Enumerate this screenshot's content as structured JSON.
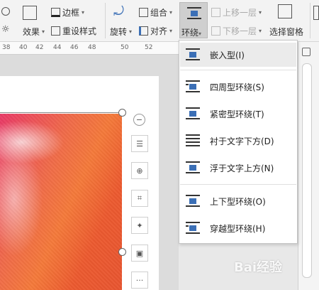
{
  "ribbon": {
    "border_label": "边框",
    "effects_label": "效果",
    "reset_style_label": "重设样式",
    "rotate_label": "旋转",
    "group_label": "组合",
    "align_label": "对齐",
    "wrap_label": "环绕",
    "bring_forward_label": "上移一层",
    "send_backward_label": "下移一层",
    "selection_pane_label": "选择窗格"
  },
  "ruler": {
    "ticks": [
      "38",
      "40",
      "42",
      "44",
      "46",
      "48",
      "50",
      "52"
    ]
  },
  "wrap_menu": {
    "items": [
      {
        "label": "嵌入型(I)"
      },
      {
        "label": "四周型环绕(S)"
      },
      {
        "label": "紧密型环绕(T)"
      },
      {
        "label": "衬于文字下方(D)"
      },
      {
        "label": "浮于文字上方(N)"
      },
      {
        "label": "上下型环绕(O)"
      },
      {
        "label": "穿越型环绕(H)"
      }
    ]
  },
  "float_tools": {
    "more_label": "···"
  },
  "watermark": {
    "text": "Bai经验"
  },
  "colors": {
    "menu_highlight": "#ebebeb",
    "icon_blue": "#3b6fb6",
    "painting": "#f06a4a"
  }
}
